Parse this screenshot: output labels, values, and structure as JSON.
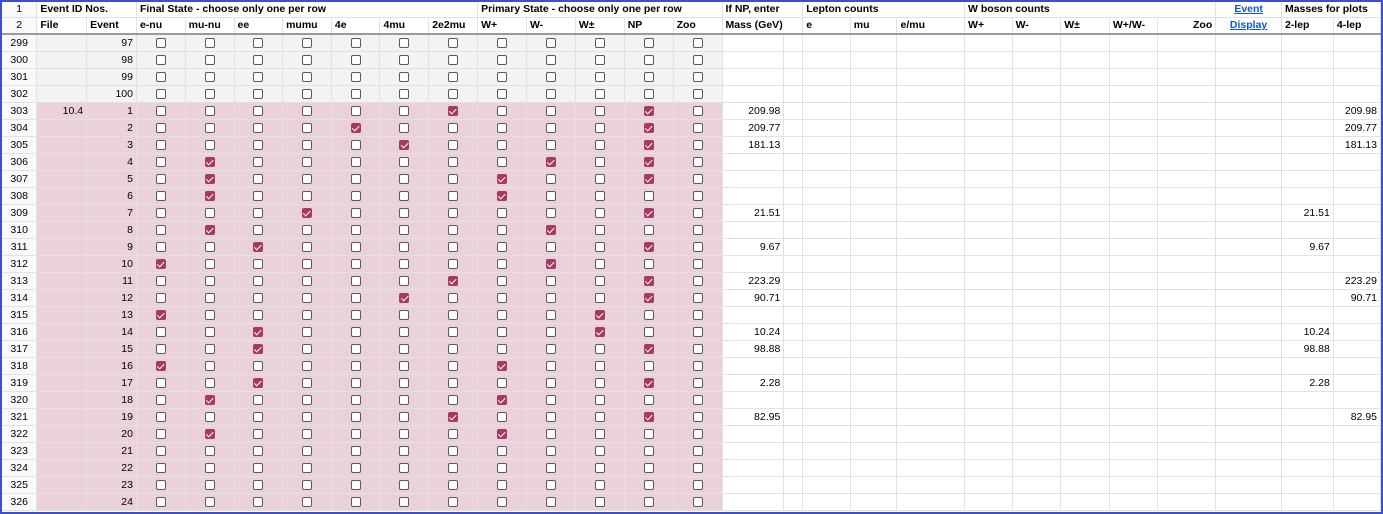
{
  "header_row1": {
    "rownum": "1",
    "event_id": "Event ID Nos.",
    "final_state": "Final State - choose only one per row",
    "primary_state": "Primary State - choose only one per row",
    "if_np": "If NP, enter",
    "lepton_counts": "Lepton counts",
    "w_boson_counts": "W boson counts",
    "event_link": "Event",
    "masses": "Masses for plots"
  },
  "header_row2": {
    "rownum": "2",
    "file": "File",
    "event": "Event",
    "final_cols": [
      "e-nu",
      "mu-nu",
      "ee",
      "mumu",
      "4e",
      "4mu",
      "2e2mu"
    ],
    "primary_cols": [
      "W+",
      "W-",
      "W±",
      "NP",
      "Zoo"
    ],
    "mass": "Mass (GeV)",
    "lepton_cols": [
      "e",
      "mu",
      "e/mu"
    ],
    "w_cols": [
      "W+",
      "W-",
      "W±",
      "W+/W-",
      "Zoo"
    ],
    "display_link": "Display",
    "mass_cols": [
      "2-lep",
      "4-lep"
    ]
  },
  "rows": [
    {
      "rownum": "299",
      "file": "",
      "event": "97",
      "final": [
        0,
        0,
        0,
        0,
        0,
        0,
        0
      ],
      "primary": [
        0,
        0,
        0,
        0,
        0
      ],
      "mass": "",
      "lep2": "",
      "lep4": "",
      "shade": "grey"
    },
    {
      "rownum": "300",
      "file": "",
      "event": "98",
      "final": [
        0,
        0,
        0,
        0,
        0,
        0,
        0
      ],
      "primary": [
        0,
        0,
        0,
        0,
        0
      ],
      "mass": "",
      "lep2": "",
      "lep4": "",
      "shade": "grey"
    },
    {
      "rownum": "301",
      "file": "",
      "event": "99",
      "final": [
        0,
        0,
        0,
        0,
        0,
        0,
        0
      ],
      "primary": [
        0,
        0,
        0,
        0,
        0
      ],
      "mass": "",
      "lep2": "",
      "lep4": "",
      "shade": "grey"
    },
    {
      "rownum": "302",
      "file": "",
      "event": "100",
      "final": [
        0,
        0,
        0,
        0,
        0,
        0,
        0
      ],
      "primary": [
        0,
        0,
        0,
        0,
        0
      ],
      "mass": "",
      "lep2": "",
      "lep4": "",
      "shade": "grey"
    },
    {
      "rownum": "303",
      "file": "10.4",
      "event": "1",
      "final": [
        0,
        0,
        0,
        0,
        0,
        0,
        1
      ],
      "primary": [
        0,
        0,
        0,
        1,
        0
      ],
      "mass": "209.98",
      "lep2": "",
      "lep4": "209.98",
      "shade": "pink"
    },
    {
      "rownum": "304",
      "file": "",
      "event": "2",
      "final": [
        0,
        0,
        0,
        0,
        1,
        0,
        0
      ],
      "primary": [
        0,
        0,
        0,
        1,
        0
      ],
      "mass": "209.77",
      "lep2": "",
      "lep4": "209.77",
      "shade": "pink"
    },
    {
      "rownum": "305",
      "file": "",
      "event": "3",
      "final": [
        0,
        0,
        0,
        0,
        0,
        1,
        0
      ],
      "primary": [
        0,
        0,
        0,
        1,
        0
      ],
      "mass": "181.13",
      "lep2": "",
      "lep4": "181.13",
      "shade": "pink"
    },
    {
      "rownum": "306",
      "file": "",
      "event": "4",
      "final": [
        0,
        1,
        0,
        0,
        0,
        0,
        0
      ],
      "primary": [
        0,
        1,
        0,
        1,
        0
      ],
      "mass": "",
      "lep2": "",
      "lep4": "",
      "shade": "pink"
    },
    {
      "rownum": "307",
      "file": "",
      "event": "5",
      "final": [
        0,
        1,
        0,
        0,
        0,
        0,
        0
      ],
      "primary": [
        1,
        0,
        0,
        1,
        0
      ],
      "mass": "",
      "lep2": "",
      "lep4": "",
      "shade": "pink"
    },
    {
      "rownum": "308",
      "file": "",
      "event": "6",
      "final": [
        0,
        1,
        0,
        0,
        0,
        0,
        0
      ],
      "primary": [
        1,
        0,
        0,
        0,
        0
      ],
      "mass": "",
      "lep2": "",
      "lep4": "",
      "shade": "pink"
    },
    {
      "rownum": "309",
      "file": "",
      "event": "7",
      "final": [
        0,
        0,
        0,
        1,
        0,
        0,
        0
      ],
      "primary": [
        0,
        0,
        0,
        1,
        0
      ],
      "mass": "21.51",
      "lep2": "21.51",
      "lep4": "",
      "shade": "pink"
    },
    {
      "rownum": "310",
      "file": "",
      "event": "8",
      "final": [
        0,
        1,
        0,
        0,
        0,
        0,
        0
      ],
      "primary": [
        0,
        1,
        0,
        0,
        0
      ],
      "mass": "",
      "lep2": "",
      "lep4": "",
      "shade": "pink"
    },
    {
      "rownum": "311",
      "file": "",
      "event": "9",
      "final": [
        0,
        0,
        1,
        0,
        0,
        0,
        0
      ],
      "primary": [
        0,
        0,
        0,
        1,
        0
      ],
      "mass": "9.67",
      "lep2": "9.67",
      "lep4": "",
      "shade": "pink"
    },
    {
      "rownum": "312",
      "file": "",
      "event": "10",
      "final": [
        1,
        0,
        0,
        0,
        0,
        0,
        0
      ],
      "primary": [
        0,
        1,
        0,
        0,
        0
      ],
      "mass": "",
      "lep2": "",
      "lep4": "",
      "shade": "pink"
    },
    {
      "rownum": "313",
      "file": "",
      "event": "11",
      "final": [
        0,
        0,
        0,
        0,
        0,
        0,
        1
      ],
      "primary": [
        0,
        0,
        0,
        1,
        0
      ],
      "mass": "223.29",
      "lep2": "",
      "lep4": "223.29",
      "shade": "pink"
    },
    {
      "rownum": "314",
      "file": "",
      "event": "12",
      "final": [
        0,
        0,
        0,
        0,
        0,
        1,
        0
      ],
      "primary": [
        0,
        0,
        0,
        1,
        0
      ],
      "mass": "90.71",
      "lep2": "",
      "lep4": "90.71",
      "shade": "pink"
    },
    {
      "rownum": "315",
      "file": "",
      "event": "13",
      "final": [
        1,
        0,
        0,
        0,
        0,
        0,
        0
      ],
      "primary": [
        0,
        0,
        1,
        0,
        0
      ],
      "mass": "",
      "lep2": "",
      "lep4": "",
      "shade": "pink"
    },
    {
      "rownum": "316",
      "file": "",
      "event": "14",
      "final": [
        0,
        0,
        1,
        0,
        0,
        0,
        0
      ],
      "primary": [
        0,
        0,
        1,
        0,
        0
      ],
      "mass": "10.24",
      "lep2": "10.24",
      "lep4": "",
      "shade": "pink"
    },
    {
      "rownum": "317",
      "file": "",
      "event": "15",
      "final": [
        0,
        0,
        1,
        0,
        0,
        0,
        0
      ],
      "primary": [
        0,
        0,
        0,
        1,
        0
      ],
      "mass": "98.88",
      "lep2": "98.88",
      "lep4": "",
      "shade": "pink"
    },
    {
      "rownum": "318",
      "file": "",
      "event": "16",
      "final": [
        1,
        0,
        0,
        0,
        0,
        0,
        0
      ],
      "primary": [
        1,
        0,
        0,
        0,
        0
      ],
      "mass": "",
      "lep2": "",
      "lep4": "",
      "shade": "pink"
    },
    {
      "rownum": "319",
      "file": "",
      "event": "17",
      "final": [
        0,
        0,
        1,
        0,
        0,
        0,
        0
      ],
      "primary": [
        0,
        0,
        0,
        1,
        0
      ],
      "mass": "2.28",
      "lep2": "2.28",
      "lep4": "",
      "shade": "pink"
    },
    {
      "rownum": "320",
      "file": "",
      "event": "18",
      "final": [
        0,
        1,
        0,
        0,
        0,
        0,
        0
      ],
      "primary": [
        1,
        0,
        0,
        0,
        0
      ],
      "mass": "",
      "lep2": "",
      "lep4": "",
      "shade": "pink"
    },
    {
      "rownum": "321",
      "file": "",
      "event": "19",
      "final": [
        0,
        0,
        0,
        0,
        0,
        0,
        1
      ],
      "primary": [
        0,
        0,
        0,
        1,
        0
      ],
      "mass": "82.95",
      "lep2": "",
      "lep4": "82.95",
      "shade": "pink"
    },
    {
      "rownum": "322",
      "file": "",
      "event": "20",
      "final": [
        0,
        1,
        0,
        0,
        0,
        0,
        0
      ],
      "primary": [
        1,
        0,
        0,
        0,
        0
      ],
      "mass": "",
      "lep2": "",
      "lep4": "",
      "shade": "pink"
    },
    {
      "rownum": "323",
      "file": "",
      "event": "21",
      "final": [
        0,
        0,
        0,
        0,
        0,
        0,
        0
      ],
      "primary": [
        0,
        0,
        0,
        0,
        0
      ],
      "mass": "",
      "lep2": "",
      "lep4": "",
      "shade": "pink"
    },
    {
      "rownum": "324",
      "file": "",
      "event": "22",
      "final": [
        0,
        0,
        0,
        0,
        0,
        0,
        0
      ],
      "primary": [
        0,
        0,
        0,
        0,
        0
      ],
      "mass": "",
      "lep2": "",
      "lep4": "",
      "shade": "pink"
    },
    {
      "rownum": "325",
      "file": "",
      "event": "23",
      "final": [
        0,
        0,
        0,
        0,
        0,
        0,
        0
      ],
      "primary": [
        0,
        0,
        0,
        0,
        0
      ],
      "mass": "",
      "lep2": "",
      "lep4": "",
      "shade": "pink"
    },
    {
      "rownum": "326",
      "file": "",
      "event": "24",
      "final": [
        0,
        0,
        0,
        0,
        0,
        0,
        0
      ],
      "primary": [
        0,
        0,
        0,
        0,
        0
      ],
      "mass": "",
      "lep2": "",
      "lep4": "",
      "shade": "pink"
    }
  ],
  "colors": {
    "pink_fill": "#ead1dc",
    "grey_fill": "#f3f3f3",
    "checkbox_on": "#a63a63",
    "link": "#1155cc",
    "frame": "#3c4fd0"
  }
}
